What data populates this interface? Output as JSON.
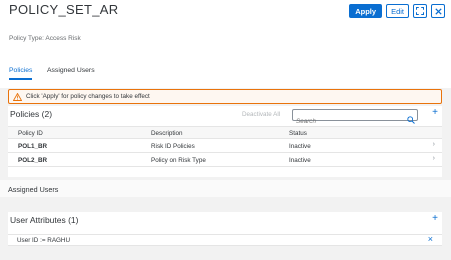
{
  "header": {
    "title": "POLICY_SET_AR",
    "subtitle": "Policy Type: Access Risk",
    "apply_label": "Apply",
    "edit_label": "Edit"
  },
  "tabs": [
    {
      "label": "Policies",
      "active": true
    },
    {
      "label": "Assigned Users",
      "active": false
    }
  ],
  "warning": {
    "text": "Click 'Apply' for policy changes to take effect"
  },
  "policies": {
    "title": "Policies (2)",
    "deactivate_label": "Deactivate All",
    "search_placeholder": "Search",
    "columns": [
      "Policy ID",
      "Description",
      "Status"
    ],
    "rows": [
      {
        "id": "POL1_BR",
        "description": "Risk ID Policies",
        "status": "Inactive"
      },
      {
        "id": "POL2_BR",
        "description": "Policy on Risk Type",
        "status": "Inactive"
      }
    ]
  },
  "assigned_users": {
    "title": "Assigned Users"
  },
  "user_attributes": {
    "title": "User Attributes (1)",
    "items": [
      {
        "text": "User ID := RAGHU"
      }
    ]
  },
  "colors": {
    "accent": "#0a6ed1",
    "warning": "#e9730c"
  }
}
